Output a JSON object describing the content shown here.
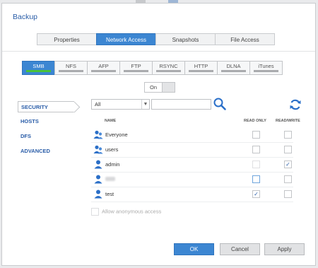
{
  "dialog": {
    "title": "Backup"
  },
  "tabs": [
    {
      "label": "Properties",
      "active": false
    },
    {
      "label": "Network Access",
      "active": true
    },
    {
      "label": "Snapshots",
      "active": false
    },
    {
      "label": "File Access",
      "active": false
    }
  ],
  "protocols": [
    {
      "label": "SMB",
      "active": true,
      "enabled": true
    },
    {
      "label": "NFS",
      "active": false,
      "enabled": false
    },
    {
      "label": "AFP",
      "active": false,
      "enabled": false
    },
    {
      "label": "FTP",
      "active": false,
      "enabled": false
    },
    {
      "label": "RSYNC",
      "active": false,
      "enabled": false
    },
    {
      "label": "HTTP",
      "active": false,
      "enabled": false
    },
    {
      "label": "DLNA",
      "active": false,
      "enabled": false
    },
    {
      "label": "iTunes",
      "active": false,
      "enabled": false
    }
  ],
  "toggle": {
    "label": "On",
    "state": true
  },
  "sidebar": {
    "items": [
      "SECURITY",
      "HOSTS",
      "DFS",
      "ADVANCED"
    ],
    "active": "SECURITY"
  },
  "filter": {
    "selected": "All",
    "search_value": ""
  },
  "table": {
    "headers": {
      "name": "NAME",
      "read_only": "READ ONLY",
      "read_write": "READ/WRITE"
    },
    "rows": [
      {
        "name": "Everyone",
        "icon": "group-icon",
        "read_only": false,
        "read_write": false
      },
      {
        "name": "users",
        "icon": "group-icon",
        "read_only": false,
        "read_write": false
      },
      {
        "name": "admin",
        "icon": "user-icon",
        "read_only": false,
        "read_write": true
      },
      {
        "name": "",
        "icon": "user-icon",
        "read_only": false,
        "read_write": false
      },
      {
        "name": "test",
        "icon": "user-icon",
        "read_only": true,
        "read_write": false
      }
    ]
  },
  "anonymous": {
    "label": "Allow anonymous access",
    "checked": false
  },
  "buttons": {
    "ok": "OK",
    "cancel": "Cancel",
    "apply": "Apply"
  },
  "colors": {
    "accent": "#3c86d2",
    "title": "#2a5da8",
    "enabled_bar": "#49c23a"
  },
  "check_glyph": "✓"
}
